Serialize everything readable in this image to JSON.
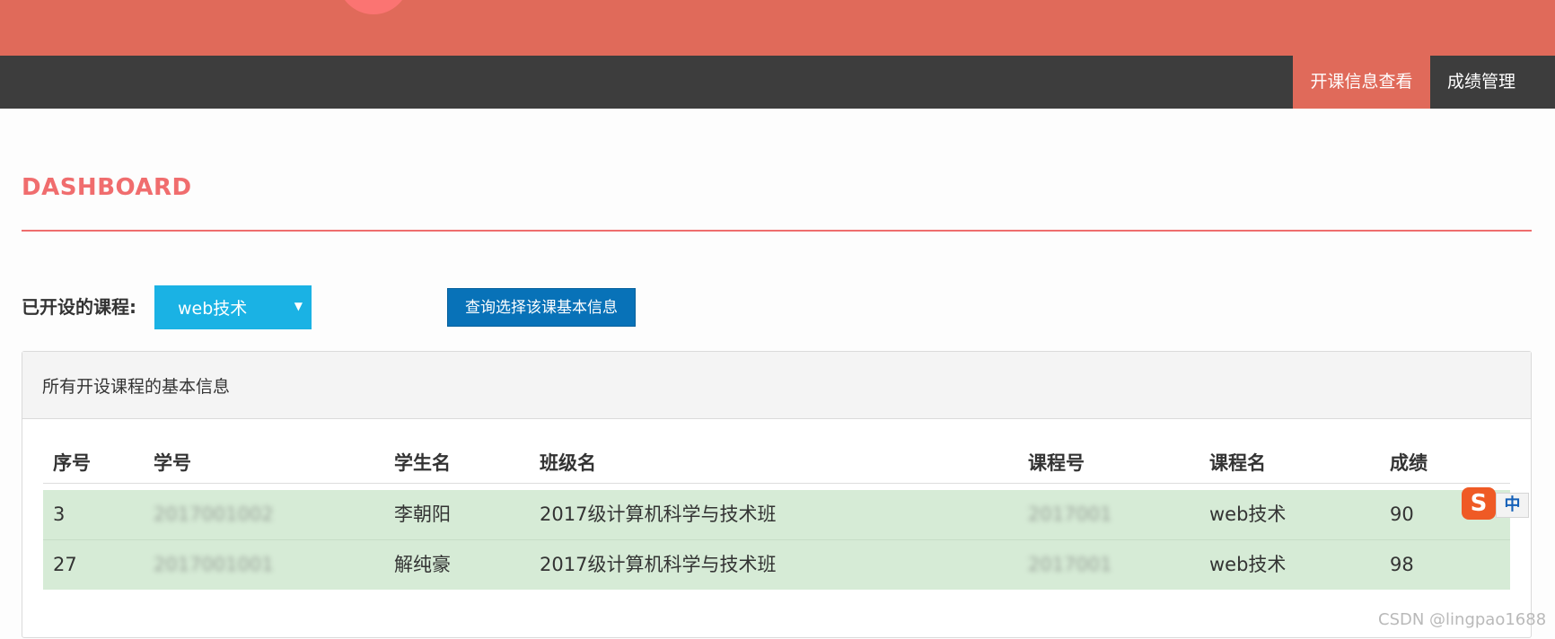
{
  "nav": {
    "items": [
      {
        "label": "开课信息查看",
        "active": true
      },
      {
        "label": "成绩管理",
        "active": false
      }
    ]
  },
  "page": {
    "title": "DASHBOARD"
  },
  "filter": {
    "label": "已开设的课程:",
    "selected_course": "web技术",
    "query_button": "查询选择该课基本信息"
  },
  "panel": {
    "title": "所有开设课程的基本信息"
  },
  "table": {
    "columns": [
      "序号",
      "学号",
      "学生名",
      "班级名",
      "课程号",
      "课程名",
      "成绩"
    ],
    "rows": [
      [
        "3",
        "2017001002",
        "李朝阳",
        "2017级计算机科学与技术班",
        "2017001",
        "web技术",
        "90"
      ],
      [
        "27",
        "2017001001",
        "解纯豪",
        "2017级计算机科学与技术班",
        "2017001",
        "web技术",
        "98"
      ]
    ]
  },
  "ime": {
    "logo": "S",
    "mode": "中"
  },
  "watermark": "CSDN @lingpao1688",
  "colors": {
    "banner": "#e06a5a",
    "navbar": "#3d3d3d",
    "accent_title": "#f06d6e",
    "select_bg": "#1ab2e4",
    "button_bg": "#0872b8",
    "row_highlight": "#d6ebd6"
  },
  "icons": {
    "select_arrow": "caret-down-icon"
  }
}
